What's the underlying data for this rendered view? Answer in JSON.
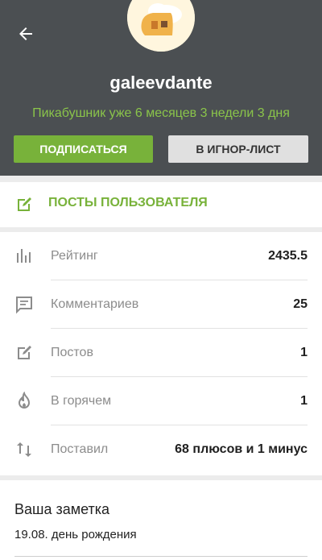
{
  "profile": {
    "username": "galeevdante",
    "since_text": "Пикабушник уже 6 месяцев 3 недели 3 дня",
    "subscribe_label": "ПОДПИСАТЬСЯ",
    "ignore_label": "В ИГНОР-ЛИСТ"
  },
  "posts_link": {
    "label": "ПОСТЫ ПОЛЬЗОВАТЕЛЯ"
  },
  "stats": [
    {
      "label": "Рейтинг",
      "value": "2435.5",
      "icon": "bar-chart-icon"
    },
    {
      "label": "Комментариев",
      "value": "25",
      "icon": "comment-icon"
    },
    {
      "label": "Постов",
      "value": "1",
      "icon": "edit-icon"
    },
    {
      "label": "В горячем",
      "value": "1",
      "icon": "fire-icon"
    },
    {
      "label": "Поставил",
      "value": "68 плюсов и 1 минус",
      "icon": "up-down-arrows-icon"
    }
  ],
  "note": {
    "title": "Ваша заметка",
    "text": "19.08. день рождения"
  },
  "colors": {
    "header": "#4b4f52",
    "accent": "#78b23a",
    "since_text": "#8ac44a"
  }
}
